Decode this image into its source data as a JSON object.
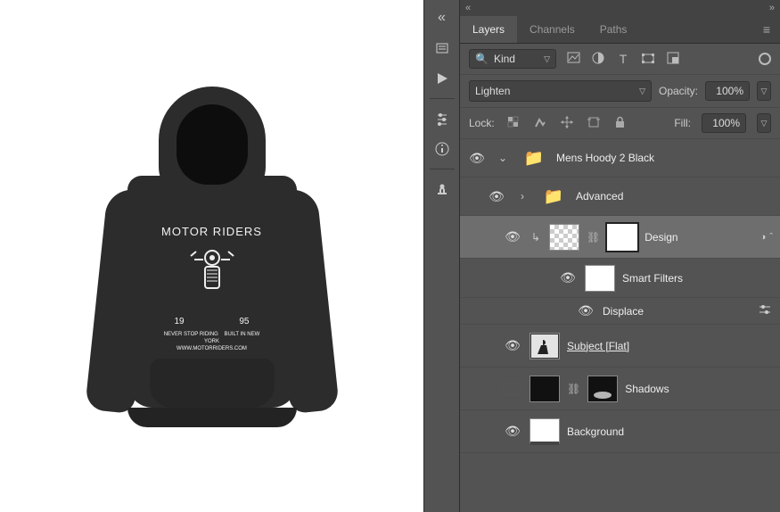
{
  "panel": {
    "tabs": [
      "Layers",
      "Channels",
      "Paths"
    ],
    "activeTab": 0,
    "filterKindLabel": "Kind",
    "blendMode": "Lighten",
    "opacityLabel": "Opacity:",
    "opacityValue": "100%",
    "lockLabel": "Lock:",
    "fillLabel": "Fill:",
    "fillValue": "100%"
  },
  "layers": [
    {
      "name": "Mens Hoody 2 Black",
      "kind": "group",
      "visible": true,
      "expanded": true,
      "depth": 0
    },
    {
      "name": "Advanced",
      "kind": "group",
      "visible": true,
      "expanded": false,
      "depth": 1
    },
    {
      "name": "Design",
      "kind": "smartobject",
      "visible": true,
      "depth": 1,
      "selected": true,
      "hasFx": true
    },
    {
      "name": "Smart Filters",
      "kind": "fxheader",
      "visible": true,
      "depth": 3
    },
    {
      "name": "Displace",
      "kind": "filter",
      "visible": true,
      "depth": 3
    },
    {
      "name": "Subject [Flat]",
      "kind": "smartobject",
      "visible": true,
      "depth": 1,
      "underline": true
    },
    {
      "name": "Shadows",
      "kind": "masked",
      "visible": false,
      "depth": 1
    },
    {
      "name": "Background",
      "kind": "layer",
      "visible": true,
      "depth": 1
    }
  ],
  "product": {
    "graphicTitle": "MOTOR RIDERS",
    "year1": "19",
    "year2": "95",
    "foot1": "NEVER STOP RIDING",
    "foot2": "BUILT IN NEW YORK",
    "url": "WWW.MOTORRIDERS.COM"
  }
}
